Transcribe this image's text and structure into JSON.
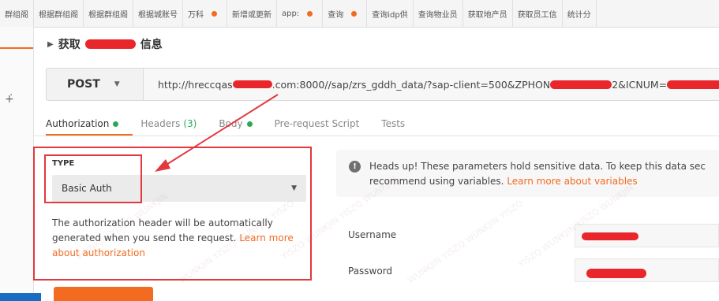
{
  "tabs": [
    {
      "label": "群组阁",
      "dot": false
    },
    {
      "label": "根据群组阁",
      "dot": false
    },
    {
      "label": "根据群组阁",
      "dot": false
    },
    {
      "label": "根据城账号",
      "dot": false
    },
    {
      "label": "万科",
      "dot": true
    },
    {
      "label": "新增或更新",
      "dot": false
    },
    {
      "label": "app:",
      "dot": true
    },
    {
      "label": "查询",
      "dot": true
    },
    {
      "label": "查询idp供",
      "dot": false
    },
    {
      "label": "查询物业员",
      "dot": false
    },
    {
      "label": "获取地产员",
      "dot": false
    },
    {
      "label": "获取员工信",
      "dot": false
    },
    {
      "label": "统计分",
      "dot": false
    }
  ],
  "request": {
    "title_prefix": "获取",
    "title_suffix": "信息",
    "method": "POST",
    "url_part1": "http://hreccqas",
    "url_part2": ".com:8000//sap/zrs_gddh_data/?sap-client=500&ZPHON",
    "url_part3": "2&ICNUM="
  },
  "request_tabs": {
    "authorization": "Authorization",
    "headers": "Headers",
    "headers_count": "(3)",
    "body": "Body",
    "pre_request": "Pre-request Script",
    "tests": "Tests"
  },
  "auth": {
    "type_label": "TYPE",
    "type_value": "Basic Auth",
    "desc_line1": "The authorization header will be automatically",
    "desc_line2": "generated when you send the request.",
    "desc_link1": "Learn more",
    "desc_link2": "about authorization"
  },
  "notice": {
    "line1": "Heads up! These parameters hold sensitive data. To keep this data sec",
    "line2_prefix": "recommend using variables.",
    "line2_link": "Learn more about variables"
  },
  "fields": {
    "username_label": "Username",
    "password_label": "Password"
  },
  "colors": {
    "accent": "#f26b21",
    "annotation_red": "#e3383d",
    "status_green": "#2aa85a"
  }
}
